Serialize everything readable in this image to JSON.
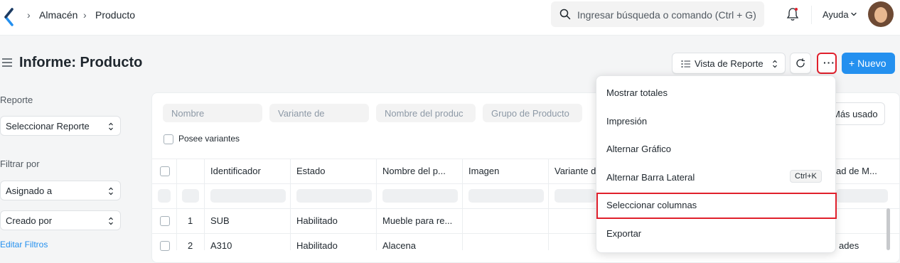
{
  "navbar": {
    "breadcrumbs": [
      "Almacén",
      "Producto"
    ],
    "search_placeholder": "Ingresar búsqueda o comando (Ctrl + G)",
    "help_label": "Ayuda"
  },
  "page": {
    "title": "Informe: Producto",
    "report_view_label": "Vista de Reporte",
    "more_label": "···",
    "new_label": "+ Nuevo"
  },
  "sidebar": {
    "report_heading": "Reporte",
    "report_select": "Seleccionar Reporte",
    "filter_heading": "Filtrar por",
    "filters": [
      "Asignado a",
      "Creado por"
    ],
    "edit_filters": "Editar Filtros"
  },
  "filters": {
    "placeholders": [
      "Nombre",
      "Variante de",
      "Nombre del produc",
      "Grupo de Producto"
    ],
    "has_variants_label": "Posee variantes",
    "sort_label": "Más usado"
  },
  "table": {
    "columns": [
      "Identificador",
      "Estado",
      "Nombre del p...",
      "Imagen",
      "Variante de",
      "ad de M..."
    ],
    "rows": [
      {
        "num": "1",
        "id": "SUB",
        "status": "Habilitado",
        "name": "Mueble para re...",
        "tail": ""
      },
      {
        "num": "2",
        "id": "A310",
        "status": "Habilitado",
        "name": "Alacena",
        "tail": "ades"
      }
    ]
  },
  "menu": {
    "items": [
      {
        "label": "Mostrar totales"
      },
      {
        "label": "Impresión"
      },
      {
        "label": "Alternar Gráfico"
      },
      {
        "label": "Alternar Barra Lateral",
        "shortcut": "Ctrl+K"
      },
      {
        "label": "Seleccionar columnas"
      },
      {
        "label": "Exportar"
      }
    ]
  },
  "colors": {
    "primary": "#2490ef",
    "highlight": "#e0202c"
  }
}
